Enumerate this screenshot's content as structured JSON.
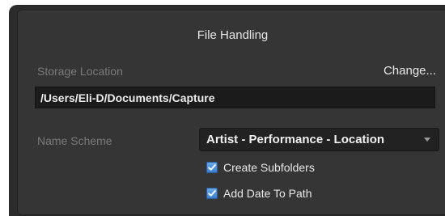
{
  "file_handling": {
    "title": "File Handling",
    "storage_location_label": "Storage Location",
    "change_label": "Change...",
    "path_value": "/Users/Eli-D/Documents/Capture",
    "name_scheme_label": "Name Scheme",
    "name_scheme_selected": "Artist - Performance - Location",
    "checkboxes": [
      {
        "label": "Create Subfolders",
        "checked": true
      },
      {
        "label": "Add Date To Path",
        "checked": true
      }
    ]
  },
  "icons": {
    "dropdown": "chevron-down-icon",
    "check": "checkmark-icon"
  },
  "colors": {
    "window_bg": "#2b2b2b",
    "panel_bg": "#353535",
    "field_bg": "#1b1b1b",
    "checkbox_accent": "#3a7fd0"
  }
}
